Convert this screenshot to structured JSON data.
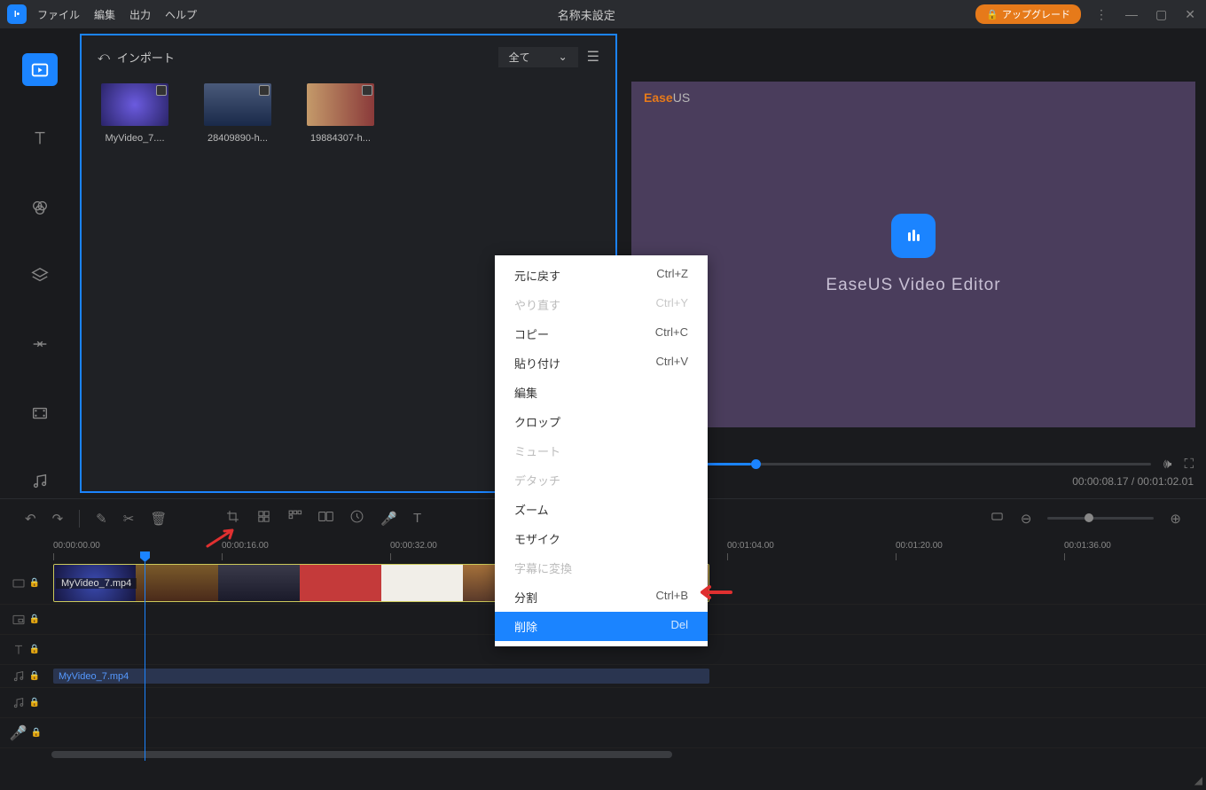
{
  "titlebar": {
    "menus": [
      "ファイル",
      "編集",
      "出力",
      "ヘルプ"
    ],
    "title": "名称未設定",
    "upgrade": "アップグレード"
  },
  "media": {
    "import_label": "インポート",
    "filter": "全て",
    "items": [
      {
        "name": "MyVideo_7...."
      },
      {
        "name": "28409890-h..."
      },
      {
        "name": "19884307-h..."
      }
    ]
  },
  "preview": {
    "brand_label": "EaseUS",
    "center_text": "EaseUS Video Editor",
    "current_time_frac": "9",
    "timecode": "00:00:08.17 / 00:01:02.01"
  },
  "timeline": {
    "ticks": [
      "00:00:00.00",
      "00:00:16.00",
      "00:00:32.00",
      "",
      "00:01:04.00",
      "00:01:20.00",
      "00:01:36.00"
    ],
    "video_clip": "MyVideo_7.mp4",
    "audio_clip": "MyVideo_7.mp4"
  },
  "context_menu": [
    {
      "label": "元に戻す",
      "shortcut": "Ctrl+Z",
      "disabled": false
    },
    {
      "label": "やり直す",
      "shortcut": "Ctrl+Y",
      "disabled": true
    },
    {
      "label": "コピー",
      "shortcut": "Ctrl+C",
      "disabled": false
    },
    {
      "label": "貼り付け",
      "shortcut": "Ctrl+V",
      "disabled": false
    },
    {
      "label": "編集",
      "shortcut": "",
      "disabled": false
    },
    {
      "label": "クロップ",
      "shortcut": "",
      "disabled": false
    },
    {
      "label": "ミュート",
      "shortcut": "",
      "disabled": true
    },
    {
      "label": "デタッチ",
      "shortcut": "",
      "disabled": true
    },
    {
      "label": "ズーム",
      "shortcut": "",
      "disabled": false
    },
    {
      "label": "モザイク",
      "shortcut": "",
      "disabled": false
    },
    {
      "label": "字幕に変換",
      "shortcut": "",
      "disabled": true
    },
    {
      "label": "分割",
      "shortcut": "Ctrl+B",
      "disabled": false
    },
    {
      "label": "削除",
      "shortcut": "Del",
      "disabled": false,
      "hover": true
    }
  ]
}
